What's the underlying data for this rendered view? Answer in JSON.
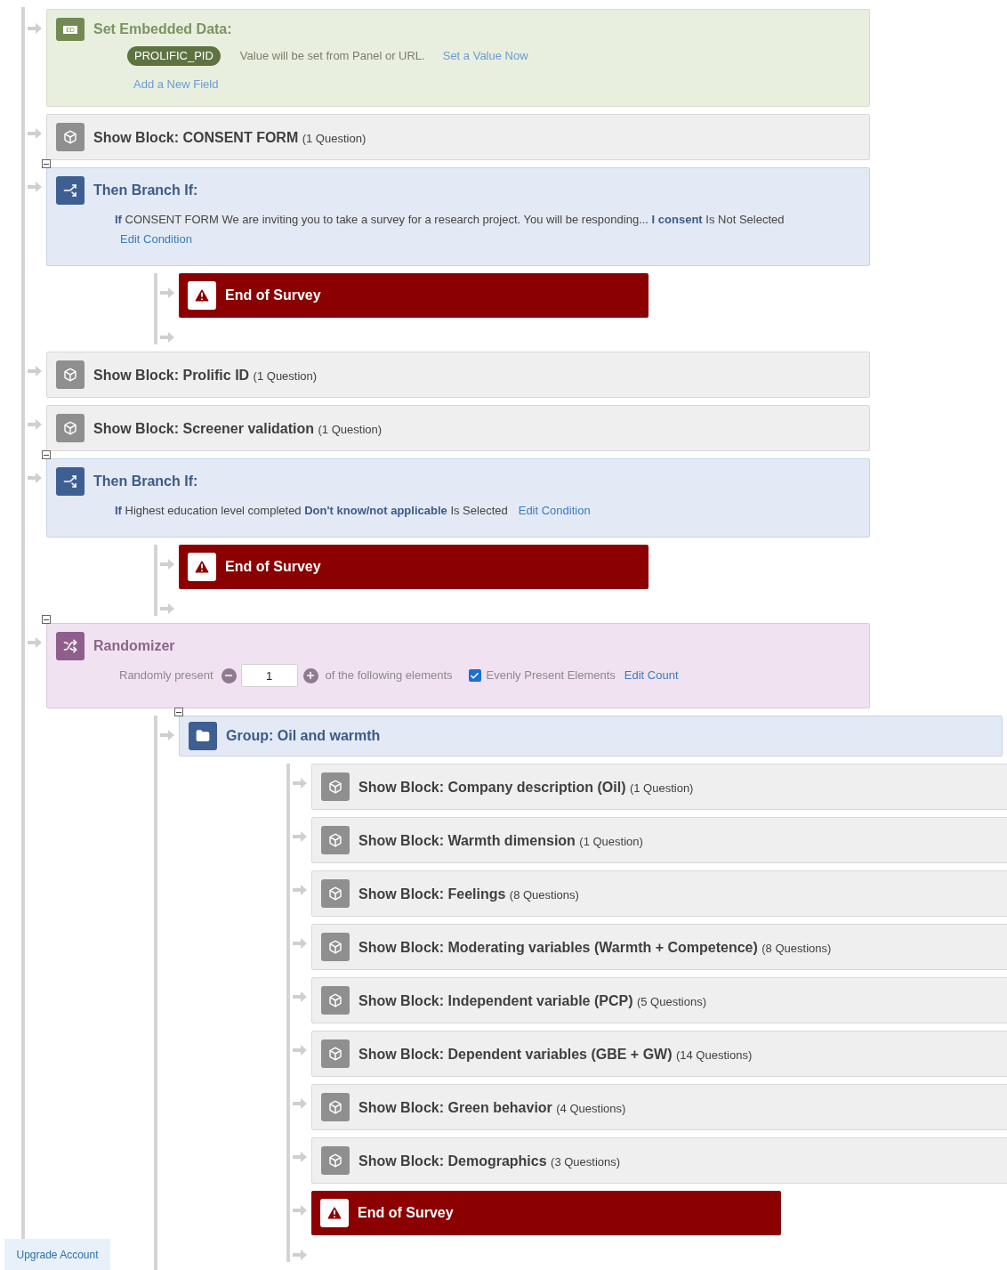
{
  "flow": [
    {
      "kind": "embedded",
      "title": "Set Embedded Data:",
      "badge": "ED",
      "fields": [
        {
          "name": "PROLIFIC_PID",
          "note": "Value will be set from Panel or URL.",
          "link": "Set a Value Now"
        }
      ],
      "add_link": "Add a New Field"
    },
    {
      "kind": "block",
      "title": "Show Block: CONSENT FORM",
      "count": "(1 Question)"
    },
    {
      "kind": "branch",
      "title": "Then Branch If:",
      "expanded": true,
      "condition": {
        "if": "If",
        "subject": "CONSENT FORM We are inviting you to take a survey for a research project. You will be responding...",
        "choice": "I consent",
        "operator": "Is Not Selected",
        "link": "Edit Condition"
      },
      "children": [
        {
          "kind": "end",
          "title": "End of Survey"
        }
      ]
    },
    {
      "kind": "block",
      "title": "Show Block: Prolific ID",
      "count": "(1 Question)"
    },
    {
      "kind": "block",
      "title": "Show Block: Screener validation",
      "count": "(1 Question)"
    },
    {
      "kind": "branch",
      "title": "Then Branch If:",
      "expanded": true,
      "condition": {
        "if": "If",
        "subject": "Highest education level completed",
        "choice": "Don't know/not applicable",
        "operator": "Is Selected",
        "link": "Edit Condition"
      },
      "children": [
        {
          "kind": "end",
          "title": "End of Survey"
        }
      ]
    },
    {
      "kind": "randomizer",
      "title": "Randomizer",
      "expanded": true,
      "label": "Randomly present",
      "count": "1",
      "after": "of the following elements",
      "evenly": {
        "checked": true,
        "label": "Evenly Present Elements"
      },
      "link": "Edit Count",
      "children": [
        {
          "kind": "group",
          "title": "Group: Oil and warmth",
          "expanded": true,
          "children": [
            {
              "kind": "block",
              "title": "Show Block: Company description (Oil)",
              "count": "(1 Question)"
            },
            {
              "kind": "block",
              "title": "Show Block: Warmth dimension",
              "count": "(1 Question)"
            },
            {
              "kind": "block",
              "title": "Show Block: Feelings",
              "count": "(8 Questions)"
            },
            {
              "kind": "block",
              "title": "Show Block: Moderating variables (Warmth + Competence)",
              "count": "(8 Questions)"
            },
            {
              "kind": "block",
              "title": "Show Block: Independent variable (PCP)",
              "count": "(5 Questions)"
            },
            {
              "kind": "block",
              "title": "Show Block: Dependent variables (GBE + GW)",
              "count": "(14 Questions)"
            },
            {
              "kind": "block",
              "title": "Show Block: Green behavior",
              "count": "(4 Questions)"
            },
            {
              "kind": "block",
              "title": "Show Block: Demographics",
              "count": "(3 Questions)"
            },
            {
              "kind": "end",
              "title": "End of Survey"
            }
          ]
        }
      ]
    }
  ],
  "upgrade": "Upgrade Account"
}
